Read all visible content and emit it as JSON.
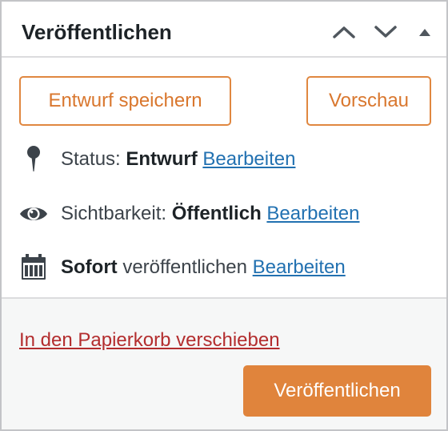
{
  "header": {
    "title": "Veröffentlichen",
    "icons": {
      "move_up": "chevron-up-icon",
      "move_down": "chevron-down-icon",
      "toggle": "triangle-up-icon"
    }
  },
  "actions": {
    "save_draft_label": "Entwurf speichern",
    "preview_label": "Vorschau"
  },
  "status": {
    "icon": "pin-icon",
    "prefix": "Status: ",
    "value": "Entwurf",
    "edit_label": "Bearbeiten"
  },
  "visibility": {
    "icon": "eye-icon",
    "prefix": "Sichtbarkeit: ",
    "value": "Öffentlich",
    "edit_label": "Bearbeiten"
  },
  "schedule": {
    "icon": "calendar-icon",
    "value": "Sofort",
    "suffix": " veröffentlichen",
    "edit_label": "Bearbeiten"
  },
  "footer": {
    "trash_label": "In den Papierkorb verschieben",
    "publish_label": "Veröffentlichen"
  },
  "colors": {
    "accent_orange": "#e0843c",
    "link_blue": "#2271b1",
    "trash_red": "#b32d2e",
    "text_dark": "#1d2327"
  }
}
